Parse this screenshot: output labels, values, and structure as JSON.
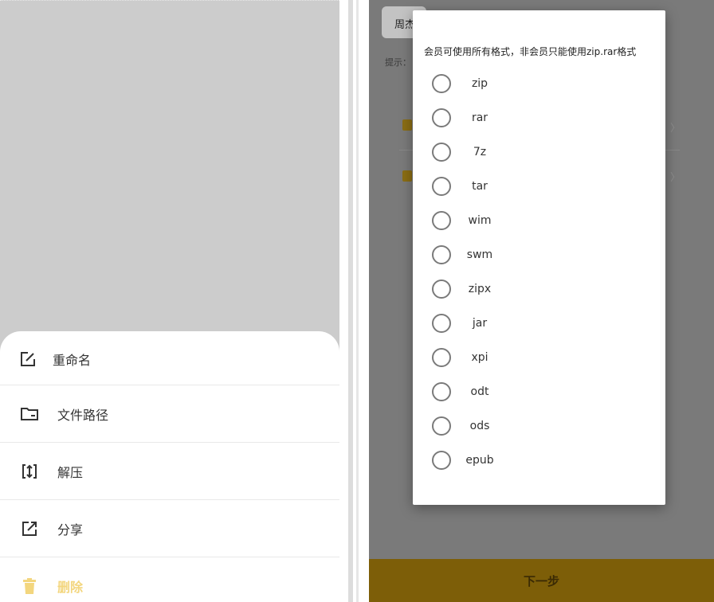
{
  "left": {
    "menu": [
      {
        "label": "重命名",
        "icon": "edit-icon"
      },
      {
        "label": "文件路径",
        "icon": "folder-icon"
      },
      {
        "label": "解压",
        "icon": "extract-icon"
      },
      {
        "label": "分享",
        "icon": "share-icon"
      },
      {
        "label": "删除",
        "icon": "trash-icon"
      }
    ]
  },
  "right": {
    "background": {
      "field_text": "周杰",
      "hint_text": "提示：",
      "chevron1": "〉",
      "chevron2": "〉"
    },
    "dialog": {
      "message": "会员可使用所有格式，非会员只能使用zip.rar格式",
      "options": [
        "zip",
        "rar",
        "7z",
        "tar",
        "wim",
        "swm",
        "zipx",
        "jar",
        "xpi",
        "odt",
        "ods",
        "epub"
      ]
    },
    "next_button": "下一步"
  },
  "colors": {
    "delete_accent": "#f3d67e",
    "next_bar": "#7d5e08",
    "overlay": "#7a7a7a"
  }
}
